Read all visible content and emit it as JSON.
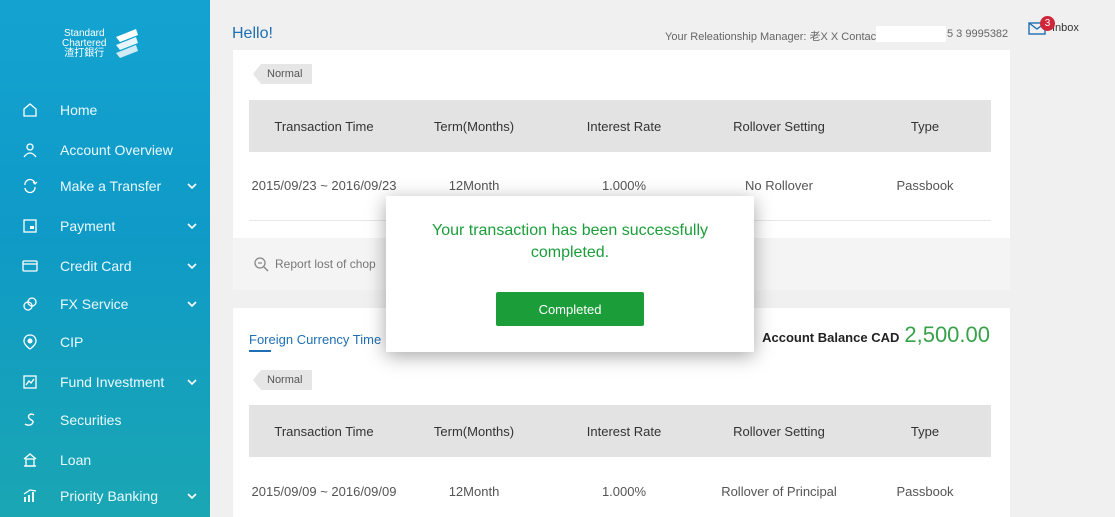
{
  "logo": {
    "line1": "Standard",
    "line2": "Chartered",
    "line3": "渣打銀行"
  },
  "sidebar": {
    "items": [
      {
        "label": "Home",
        "icon": "home-icon",
        "has_chevron": false
      },
      {
        "label": "Account Overview",
        "icon": "user-icon",
        "has_chevron": false
      },
      {
        "label": "Make a Transfer",
        "icon": "transfer-icon",
        "has_chevron": true
      },
      {
        "label": "Payment",
        "icon": "payment-icon",
        "has_chevron": true
      },
      {
        "label": "Credit Card",
        "icon": "credit-card-icon",
        "has_chevron": true
      },
      {
        "label": "FX Service",
        "icon": "fx-icon",
        "has_chevron": true
      },
      {
        "label": "CIP",
        "icon": "cip-icon",
        "has_chevron": false
      },
      {
        "label": "Fund Investment",
        "icon": "fund-icon",
        "has_chevron": true
      },
      {
        "label": "Securities",
        "icon": "securities-icon",
        "has_chevron": false
      },
      {
        "label": "Loan",
        "icon": "loan-icon",
        "has_chevron": false
      },
      {
        "label": "Priority Banking",
        "icon": "priority-banking-icon",
        "has_chevron": true
      }
    ]
  },
  "header": {
    "greeting": "Hello!",
    "relationship_text": "Your Releationship Manager: 老X X Contact",
    "phone_suffix": "5 3 9995382",
    "inbox_label": "Inbox",
    "inbox_count": "3"
  },
  "card1": {
    "tag": "Normal",
    "headers": [
      "Transaction Time",
      "Term(Months)",
      "Interest Rate",
      "Rollover Setting",
      "Type"
    ],
    "row": [
      "2015/09/23 ~ 2016/09/23",
      "12Month",
      "1.000%",
      "No Rollover",
      "Passbook"
    ],
    "report_link": "Report lost of chop"
  },
  "card2": {
    "title": "Foreign Currency Time",
    "balance_label": "Account Balance CAD",
    "balance_value": "2,500.00",
    "tag": "Normal",
    "headers": [
      "Transaction Time",
      "Term(Months)",
      "Interest Rate",
      "Rollover Setting",
      "Type"
    ],
    "row": [
      "2015/09/09 ~ 2016/09/09",
      "12Month",
      "1.000%",
      "Rollover of Principal",
      "Passbook"
    ]
  },
  "modal": {
    "message": "Your transaction has been successfully completed.",
    "button_label": "Completed"
  },
  "colors": {
    "sidebar_top": "#14a3d1",
    "sidebar_bottom": "#1aa6b3",
    "accent_blue": "#1e6fb3",
    "success_green": "#1b9e3a",
    "balance_green": "#37a24a",
    "badge_red": "#d0263a"
  }
}
